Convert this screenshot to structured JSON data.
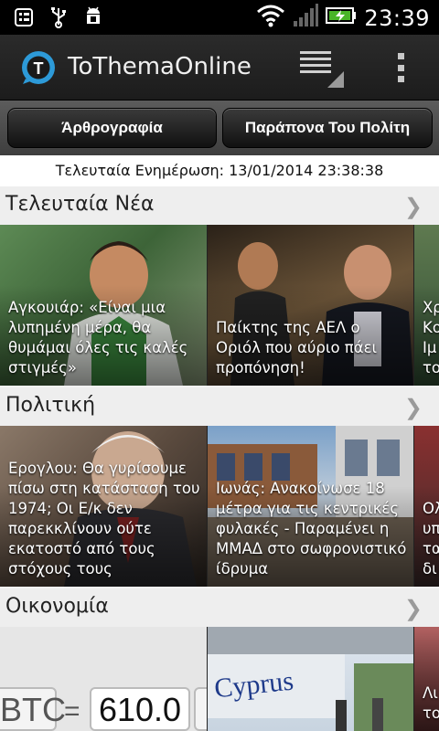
{
  "status_bar": {
    "time": "23:39",
    "icons": [
      "notes-icon",
      "usb-icon",
      "android-debug-icon",
      "wifi-icon",
      "signal-icon",
      "battery-charging-icon"
    ]
  },
  "app": {
    "title": "ToThemaOnline",
    "logo_letter": "T",
    "accent": "#2d9ad8"
  },
  "tabs": [
    {
      "label": "Άρθρογραφία"
    },
    {
      "label": "Παράπονα Του Πολίτη"
    }
  ],
  "update_text": "Τελευταία Ενημέρωση: 13/01/2014 23:38:38",
  "sections": [
    {
      "title": "Τελευταία Νέα",
      "tiles": [
        {
          "caption": "Αγκουιάρ: «Είναι μια λυπημένη μέρα, θα θυμάμαι όλες τις καλές στιγμές»"
        },
        {
          "caption": "Παίκτης της ΑΕΛ ο Οριόλ που αύριο πάει προπόνηση!"
        },
        {
          "caption": "Χρ Κο Ιμ το"
        }
      ]
    },
    {
      "title": "Πολιτική",
      "tiles": [
        {
          "caption": "Ερογλου: Θα γυρίσουμε πίσω στη κατάσταση του 1974; Οι Ε/κ δεν παρεκκλίνουν ούτε εκατοστό από τους στόχους τους"
        },
        {
          "caption": "Ιωνάς: Ανακοίνωσε 18 μέτρα για τις κεντρικές φυλακές - Παραμένει η ΜΜΑΔ στο σωφρονιστικό ίδρυμα"
        },
        {
          "caption": "Ολ υπ τα δι"
        }
      ]
    },
    {
      "title": "Οικονομία",
      "tiles": [
        {
          "caption": "",
          "btc_label": "BTC",
          "btc_eq": "=",
          "btc_value": "610.0"
        },
        {
          "caption": ""
        },
        {
          "caption": "Λι το"
        }
      ]
    }
  ]
}
